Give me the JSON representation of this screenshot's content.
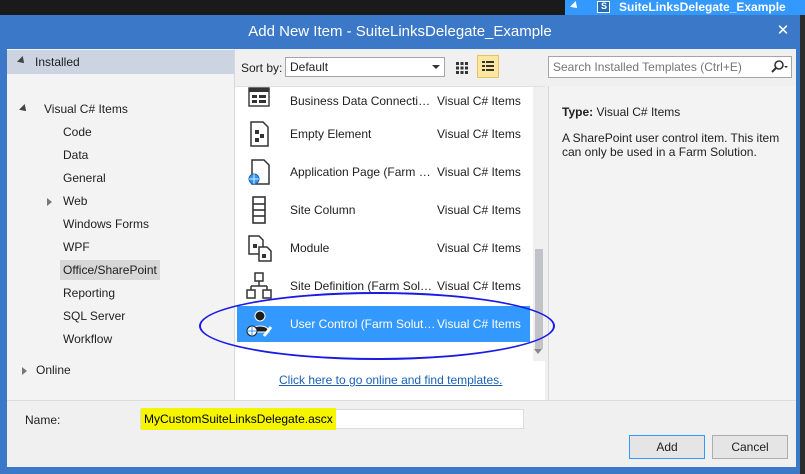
{
  "ide": {
    "project_name": "SuiteLinksDelegate_Example"
  },
  "dialog": {
    "title": "Add New Item - SuiteLinksDelegate_Example",
    "close_glyph": "✕"
  },
  "left_panel": {
    "installed_label": "Installed",
    "visual_csharp_label": "Visual C# Items",
    "items": [
      {
        "label": "Code"
      },
      {
        "label": "Data"
      },
      {
        "label": "General"
      },
      {
        "label": "Web"
      },
      {
        "label": "Windows Forms"
      },
      {
        "label": "WPF"
      },
      {
        "label": "Office/SharePoint",
        "selected": true
      },
      {
        "label": "Reporting"
      },
      {
        "label": "SQL Server"
      },
      {
        "label": "Workflow"
      }
    ],
    "online_label": "Online"
  },
  "toolbar": {
    "sort_label": "Sort by:",
    "sort_value": "Default",
    "search_placeholder": "Search Installed Templates (Ctrl+E)"
  },
  "templates": [
    {
      "name": "Business Data Connectivit...",
      "category": "Visual C# Items",
      "icon": "bdc-model-icon"
    },
    {
      "name": "Empty Element",
      "category": "Visual C# Items",
      "icon": "empty-element-icon"
    },
    {
      "name": "Application Page (Farm S...",
      "category": "Visual C# Items",
      "icon": "application-page-icon"
    },
    {
      "name": "Site Column",
      "category": "Visual C# Items",
      "icon": "site-column-icon"
    },
    {
      "name": "Module",
      "category": "Visual C# Items",
      "icon": "module-icon"
    },
    {
      "name": "Site Definition (Farm Solu...",
      "category": "Visual C# Items",
      "icon": "site-definition-icon"
    },
    {
      "name": "User Control (Farm Soluti...",
      "category": "Visual C# Items",
      "icon": "user-control-icon",
      "selected": true
    }
  ],
  "online_link": "Click here to go online and find templates.",
  "details": {
    "type_key": "Type:",
    "type_value": "Visual C# Items",
    "description": "A SharePoint user control item. This item can only be used in a Farm Solution."
  },
  "bottom": {
    "name_label": "Name:",
    "name_value": "MyCustomSuiteLinksDelegate.ascx",
    "add_label": "Add",
    "cancel_label": "Cancel"
  },
  "colors": {
    "accent": "#3399ff",
    "title_bar": "#3c78c8",
    "annotation": "#1a1ae6",
    "highlight": "#f5f500"
  }
}
